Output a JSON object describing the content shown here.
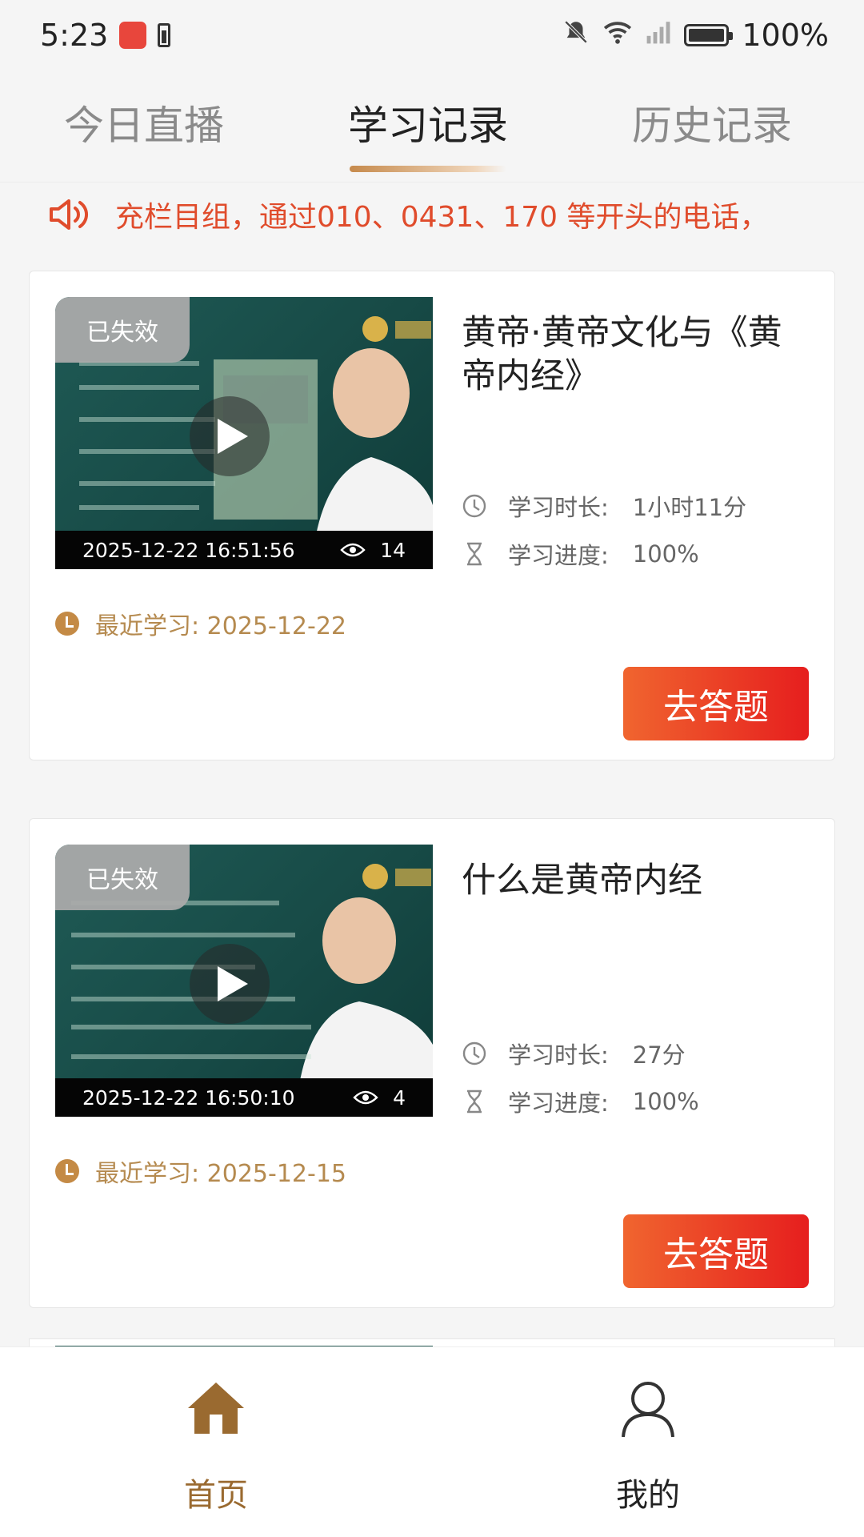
{
  "status_bar": {
    "time": "5:23",
    "battery_text": "100%"
  },
  "tabs": [
    {
      "label": "今日直播",
      "active": false
    },
    {
      "label": "学习记录",
      "active": true
    },
    {
      "label": "历史记录",
      "active": false
    }
  ],
  "notice": {
    "text": "充栏目组，通过010、0431、170 等开头的电话，",
    "icon": "speaker-icon"
  },
  "records": [
    {
      "badge": "已失效",
      "timestamp": "2025-12-22 16:51:56",
      "views": "14",
      "title": "黄帝·黄帝文化与《黄帝内经》",
      "duration_label": "学习时长:",
      "duration_value": "1小时11分",
      "progress_label": "学习进度:",
      "progress_value": "100%",
      "recent_label": "最近学习: 2025-12-22",
      "button_label": "去答题"
    },
    {
      "badge": "已失效",
      "timestamp": "2025-12-22 16:50:10",
      "views": "4",
      "title": "什么是黄帝内经",
      "duration_label": "学习时长:",
      "duration_value": "27分",
      "progress_label": "学习进度:",
      "progress_value": "100%",
      "recent_label": "最近学习: 2025-12-15",
      "button_label": "去答题"
    }
  ],
  "bottom_nav": [
    {
      "label": "首页",
      "icon": "home-icon",
      "active": true
    },
    {
      "label": "我的",
      "icon": "user-icon",
      "active": false
    }
  ],
  "colors": {
    "accent_brown": "#9a6a30",
    "notice_red": "#e04c2c",
    "button_gradient_start": "#f0652f",
    "button_gradient_end": "#e61e1e"
  }
}
